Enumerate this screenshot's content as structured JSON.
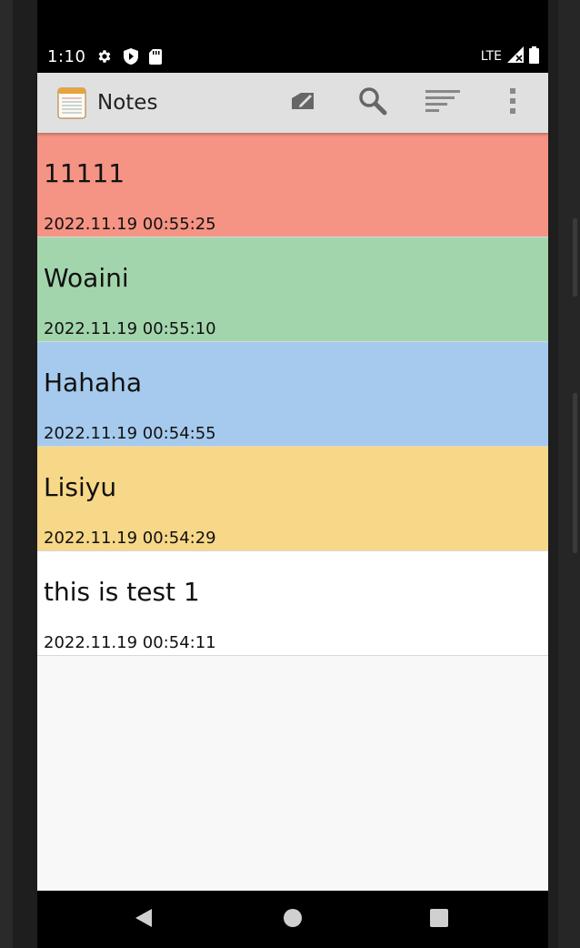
{
  "status_bar": {
    "time": "1:10",
    "network": "LTE",
    "icons": [
      "settings-icon",
      "shield-icon",
      "sd-card-icon",
      "signal-icon",
      "battery-icon"
    ]
  },
  "app_bar": {
    "title": "Notes",
    "actions": [
      "new-note-icon",
      "search-icon",
      "sort-icon",
      "more-vert-icon"
    ]
  },
  "notes": [
    {
      "title": "11111",
      "date": "2022.11.19 00:55:25",
      "color": "#f59484"
    },
    {
      "title": "Woaini",
      "date": "2022.11.19 00:55:10",
      "color": "#a3d5ad"
    },
    {
      "title": "Hahaha",
      "date": "2022.11.19 00:54:55",
      "color": "#a6caed"
    },
    {
      "title": "Lisiyu",
      "date": "2022.11.19 00:54:29",
      "color": "#f7d788"
    },
    {
      "title": "this is test 1",
      "date": "2022.11.19 00:54:11",
      "color": "#ffffff"
    }
  ],
  "nav_bar": {
    "buttons": [
      "back-icon",
      "home-icon",
      "recents-icon"
    ]
  }
}
